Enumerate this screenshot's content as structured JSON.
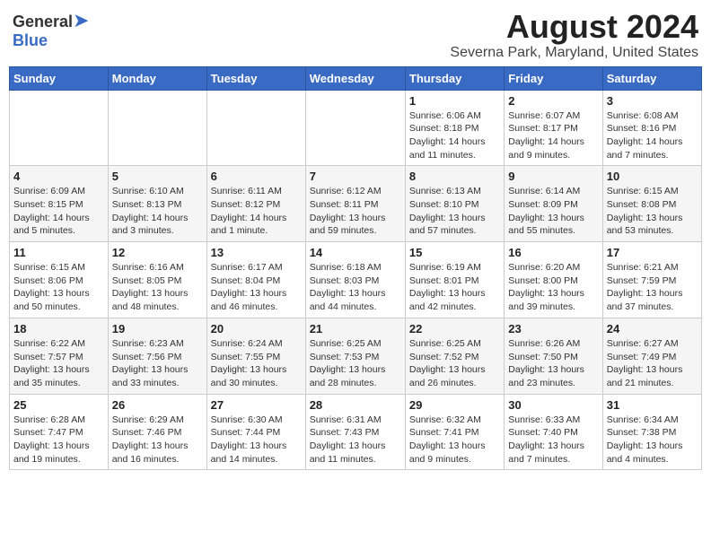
{
  "header": {
    "logo_general": "General",
    "logo_blue": "Blue",
    "title": "August 2024",
    "subtitle": "Severna Park, Maryland, United States"
  },
  "columns": [
    "Sunday",
    "Monday",
    "Tuesday",
    "Wednesday",
    "Thursday",
    "Friday",
    "Saturday"
  ],
  "weeks": [
    [
      {
        "day": "",
        "info": ""
      },
      {
        "day": "",
        "info": ""
      },
      {
        "day": "",
        "info": ""
      },
      {
        "day": "",
        "info": ""
      },
      {
        "day": "1",
        "info": "Sunrise: 6:06 AM\nSunset: 8:18 PM\nDaylight: 14 hours\nand 11 minutes."
      },
      {
        "day": "2",
        "info": "Sunrise: 6:07 AM\nSunset: 8:17 PM\nDaylight: 14 hours\nand 9 minutes."
      },
      {
        "day": "3",
        "info": "Sunrise: 6:08 AM\nSunset: 8:16 PM\nDaylight: 14 hours\nand 7 minutes."
      }
    ],
    [
      {
        "day": "4",
        "info": "Sunrise: 6:09 AM\nSunset: 8:15 PM\nDaylight: 14 hours\nand 5 minutes."
      },
      {
        "day": "5",
        "info": "Sunrise: 6:10 AM\nSunset: 8:13 PM\nDaylight: 14 hours\nand 3 minutes."
      },
      {
        "day": "6",
        "info": "Sunrise: 6:11 AM\nSunset: 8:12 PM\nDaylight: 14 hours\nand 1 minute."
      },
      {
        "day": "7",
        "info": "Sunrise: 6:12 AM\nSunset: 8:11 PM\nDaylight: 13 hours\nand 59 minutes."
      },
      {
        "day": "8",
        "info": "Sunrise: 6:13 AM\nSunset: 8:10 PM\nDaylight: 13 hours\nand 57 minutes."
      },
      {
        "day": "9",
        "info": "Sunrise: 6:14 AM\nSunset: 8:09 PM\nDaylight: 13 hours\nand 55 minutes."
      },
      {
        "day": "10",
        "info": "Sunrise: 6:15 AM\nSunset: 8:08 PM\nDaylight: 13 hours\nand 53 minutes."
      }
    ],
    [
      {
        "day": "11",
        "info": "Sunrise: 6:15 AM\nSunset: 8:06 PM\nDaylight: 13 hours\nand 50 minutes."
      },
      {
        "day": "12",
        "info": "Sunrise: 6:16 AM\nSunset: 8:05 PM\nDaylight: 13 hours\nand 48 minutes."
      },
      {
        "day": "13",
        "info": "Sunrise: 6:17 AM\nSunset: 8:04 PM\nDaylight: 13 hours\nand 46 minutes."
      },
      {
        "day": "14",
        "info": "Sunrise: 6:18 AM\nSunset: 8:03 PM\nDaylight: 13 hours\nand 44 minutes."
      },
      {
        "day": "15",
        "info": "Sunrise: 6:19 AM\nSunset: 8:01 PM\nDaylight: 13 hours\nand 42 minutes."
      },
      {
        "day": "16",
        "info": "Sunrise: 6:20 AM\nSunset: 8:00 PM\nDaylight: 13 hours\nand 39 minutes."
      },
      {
        "day": "17",
        "info": "Sunrise: 6:21 AM\nSunset: 7:59 PM\nDaylight: 13 hours\nand 37 minutes."
      }
    ],
    [
      {
        "day": "18",
        "info": "Sunrise: 6:22 AM\nSunset: 7:57 PM\nDaylight: 13 hours\nand 35 minutes."
      },
      {
        "day": "19",
        "info": "Sunrise: 6:23 AM\nSunset: 7:56 PM\nDaylight: 13 hours\nand 33 minutes."
      },
      {
        "day": "20",
        "info": "Sunrise: 6:24 AM\nSunset: 7:55 PM\nDaylight: 13 hours\nand 30 minutes."
      },
      {
        "day": "21",
        "info": "Sunrise: 6:25 AM\nSunset: 7:53 PM\nDaylight: 13 hours\nand 28 minutes."
      },
      {
        "day": "22",
        "info": "Sunrise: 6:25 AM\nSunset: 7:52 PM\nDaylight: 13 hours\nand 26 minutes."
      },
      {
        "day": "23",
        "info": "Sunrise: 6:26 AM\nSunset: 7:50 PM\nDaylight: 13 hours\nand 23 minutes."
      },
      {
        "day": "24",
        "info": "Sunrise: 6:27 AM\nSunset: 7:49 PM\nDaylight: 13 hours\nand 21 minutes."
      }
    ],
    [
      {
        "day": "25",
        "info": "Sunrise: 6:28 AM\nSunset: 7:47 PM\nDaylight: 13 hours\nand 19 minutes."
      },
      {
        "day": "26",
        "info": "Sunrise: 6:29 AM\nSunset: 7:46 PM\nDaylight: 13 hours\nand 16 minutes."
      },
      {
        "day": "27",
        "info": "Sunrise: 6:30 AM\nSunset: 7:44 PM\nDaylight: 13 hours\nand 14 minutes."
      },
      {
        "day": "28",
        "info": "Sunrise: 6:31 AM\nSunset: 7:43 PM\nDaylight: 13 hours\nand 11 minutes."
      },
      {
        "day": "29",
        "info": "Sunrise: 6:32 AM\nSunset: 7:41 PM\nDaylight: 13 hours\nand 9 minutes."
      },
      {
        "day": "30",
        "info": "Sunrise: 6:33 AM\nSunset: 7:40 PM\nDaylight: 13 hours\nand 7 minutes."
      },
      {
        "day": "31",
        "info": "Sunrise: 6:34 AM\nSunset: 7:38 PM\nDaylight: 13 hours\nand 4 minutes."
      }
    ]
  ]
}
